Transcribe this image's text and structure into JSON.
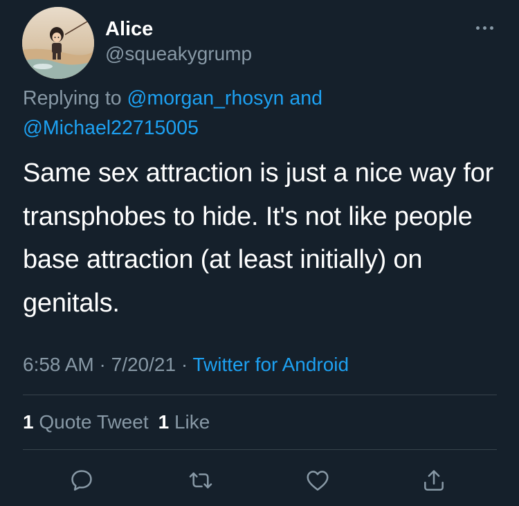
{
  "author": {
    "display_name": "Alice",
    "handle": "@squeakygrump"
  },
  "reply": {
    "prefix": "Replying to ",
    "mention_1": "@morgan_rhosyn",
    "conjunction": " and",
    "mention_2": "@Michael22715005"
  },
  "tweet_text": "Same sex attraction is just a nice way for transphobes to hide. It's not like people base attraction (at least initially) on genitals.",
  "meta": {
    "time": "6:58 AM",
    "separator": " · ",
    "date": "7/20/21",
    "source": "Twitter for Android"
  },
  "stats": {
    "quote_count": "1",
    "quote_label": " Quote Tweet",
    "like_count": "1",
    "like_label": " Like"
  },
  "icons": {
    "more": "more-options-icon",
    "reply": "reply-icon",
    "retweet": "retweet-icon",
    "like": "heart-icon",
    "share": "share-icon"
  },
  "colors": {
    "background": "#15202b",
    "accent": "#1da1f2",
    "secondary_text": "#8899a6",
    "divider": "#38444d"
  }
}
